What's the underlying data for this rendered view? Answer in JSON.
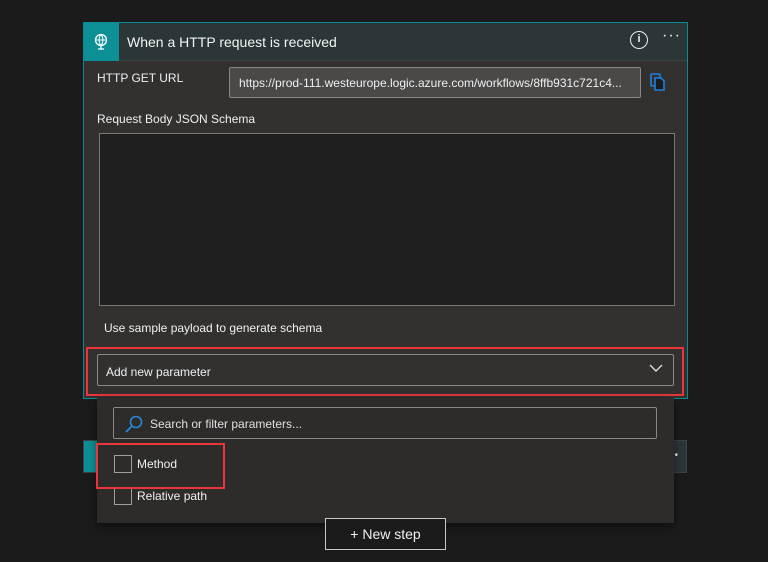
{
  "trigger_card": {
    "title": "When a HTTP request is received",
    "icon": "globe-request-icon",
    "url_label": "HTTP GET URL",
    "url_value": "https://prod-111.westeurope.logic.azure.com/workflows/8ffb931c721c4...",
    "schema_label": "Request Body JSON Schema",
    "schema_value": "",
    "sample_link": "Use sample payload to generate schema",
    "add_parameter": "Add new parameter",
    "accent": "#0d8f96"
  },
  "dropdown": {
    "search_placeholder": "Search or filter parameters...",
    "options": [
      {
        "label": "Method",
        "checked": false
      },
      {
        "label": "Relative path",
        "checked": false
      }
    ]
  },
  "new_step": "+ New step",
  "highlight_color": "#e8363b"
}
